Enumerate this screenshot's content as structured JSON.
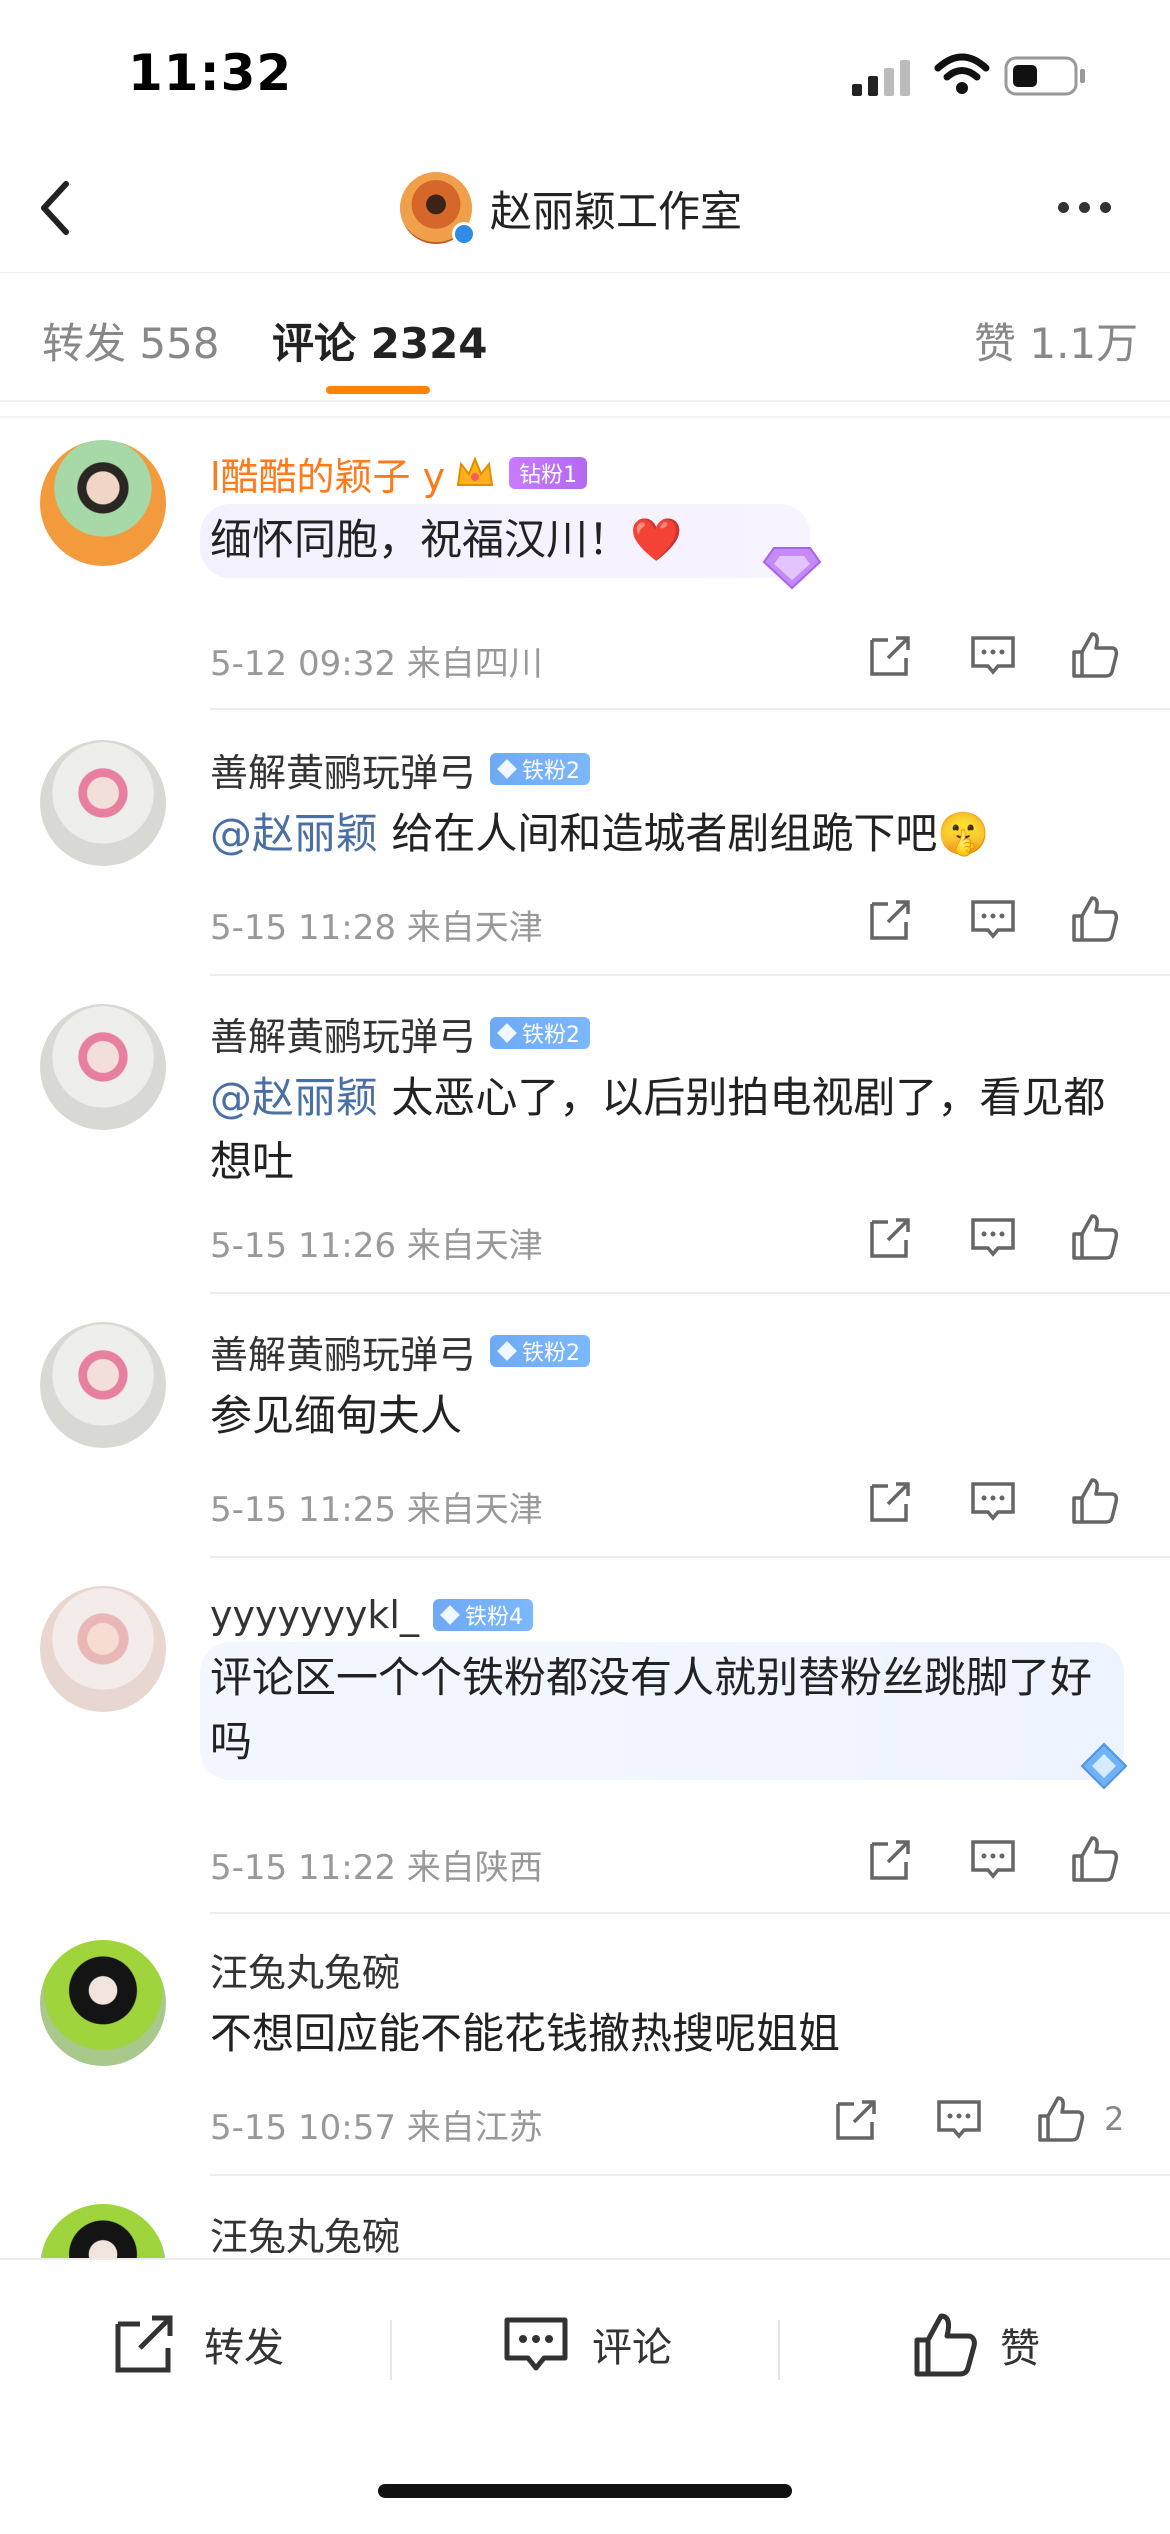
{
  "status_bar": {
    "time": "11:32"
  },
  "nav": {
    "title": "赵丽颖工作室"
  },
  "tabs": {
    "repost": "转发 558",
    "comments": "评论 2324",
    "likes": "赞 1.1万"
  },
  "comments": [
    {
      "user": "l酷酷的颖子 y",
      "badge": "钻粉1",
      "text": "缅怀同胞，祝福汉川！❤️",
      "meta": "5-12 09:32  来自四川",
      "likes": ""
    },
    {
      "user": "善解黄鹂玩弹弓",
      "badge": "铁粉2",
      "mention": "@赵丽颖",
      "text": " 给在人间和造城者剧组跪下吧🤫",
      "meta": "5-15 11:28  来自天津",
      "likes": ""
    },
    {
      "user": "善解黄鹂玩弹弓",
      "badge": "铁粉2",
      "mention": "@赵丽颖",
      "text": " 太恶心了，以后别拍电视剧了，看见都想吐",
      "meta": "5-15 11:26  来自天津",
      "likes": ""
    },
    {
      "user": "善解黄鹂玩弹弓",
      "badge": "铁粉2",
      "text": "参见缅甸夫人",
      "meta": "5-15 11:25  来自天津",
      "likes": ""
    },
    {
      "user": "yyyyyyykl_",
      "badge": "铁粉4",
      "text": "评论区一个个铁粉都没有人就别替粉丝跳脚了好吗",
      "meta": "5-15 11:22  来自陕西",
      "likes": ""
    },
    {
      "user": "汪兔丸兔碗",
      "text": "不想回应能不能花钱撤热搜呢姐姐",
      "meta": "5-15 10:57  来自江苏",
      "likes": "2"
    },
    {
      "user": "汪兔丸兔碗"
    }
  ],
  "bottom_bar": {
    "repost": "转发",
    "comment": "评论",
    "like": "赞"
  },
  "colors": {
    "accent": "#ff8200",
    "mention": "#4a6fa5",
    "badge_blue": "#6fa9f5",
    "badge_purple": "#b269f0"
  },
  "icons": [
    "back-icon",
    "more-icon",
    "share-icon",
    "comment-icon",
    "like-icon"
  ]
}
